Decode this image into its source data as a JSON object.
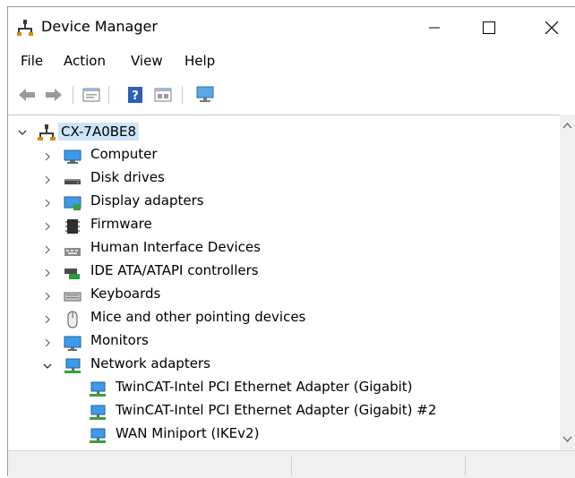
{
  "window": {
    "title": "Device Manager"
  },
  "menu": [
    "File",
    "Action",
    "View",
    "Help"
  ],
  "toolbar": [
    "back-icon",
    "forward-icon",
    "properties-icon",
    "help-icon",
    "details-icon",
    "scan-hardware-icon"
  ],
  "tree": {
    "root": "CX-7A0BE8",
    "categories": [
      {
        "label": "Computer",
        "icon": "computer-icon"
      },
      {
        "label": "Disk drives",
        "icon": "disk-drive-icon"
      },
      {
        "label": "Display adapters",
        "icon": "display-adapter-icon"
      },
      {
        "label": "Firmware",
        "icon": "firmware-icon"
      },
      {
        "label": "Human Interface Devices",
        "icon": "hid-icon"
      },
      {
        "label": "IDE ATA/ATAPI controllers",
        "icon": "ide-controller-icon"
      },
      {
        "label": "Keyboards",
        "icon": "keyboard-icon"
      },
      {
        "label": "Mice and other pointing devices",
        "icon": "mouse-icon"
      },
      {
        "label": "Monitors",
        "icon": "monitor-icon"
      },
      {
        "label": "Network adapters",
        "icon": "network-adapter-icon"
      }
    ],
    "network_children": [
      "TwinCAT-Intel PCI Ethernet Adapter (Gigabit)",
      "TwinCAT-Intel PCI Ethernet Adapter (Gigabit) #2",
      "WAN Miniport (IKEv2)"
    ]
  },
  "colors": {
    "selection": "#cce4f7",
    "accent": "#1a74c9"
  }
}
